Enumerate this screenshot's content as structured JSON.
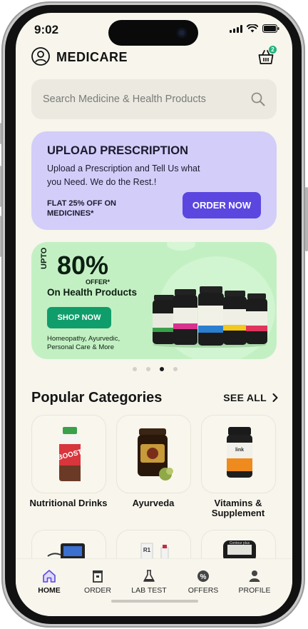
{
  "status": {
    "time": "9:02"
  },
  "header": {
    "app_title": "MEDICARE",
    "cart_count": "2"
  },
  "search": {
    "placeholder": "Search Medicine & Health Products"
  },
  "upload_card": {
    "title": "UPLOAD PRESCRIPTION",
    "description": "Upload a Prescription and Tell Us what you Need. We do the Rest.!",
    "offer": "FLAT 25% OFF ON MEDICINES*",
    "button": "ORDER NOW",
    "bg_color": "#d3cdf9",
    "button_color": "#5b47e0"
  },
  "promo_card": {
    "upto": "UPTO",
    "percent": "80%",
    "offer": "OFFER*",
    "headline": "On Health Products",
    "button": "SHOP NOW",
    "subtitle": "Homeopathy, Ayurvedic, Personal Care & More",
    "bg_color": "#c3f0c3",
    "button_color": "#0f9d6b"
  },
  "carousel": {
    "count": 4,
    "active_index": 2
  },
  "categories": {
    "title": "Popular Categories",
    "see_all": "SEE ALL",
    "items": [
      {
        "name": "Nutritional Drinks"
      },
      {
        "name": "Ayurveda"
      },
      {
        "name": "Vitamins & Supplement"
      }
    ]
  },
  "tabbar": {
    "items": [
      {
        "label": "HOME",
        "icon": "home-icon",
        "active": true
      },
      {
        "label": "ORDER",
        "icon": "order-icon",
        "active": false
      },
      {
        "label": "LAB TEST",
        "icon": "flask-icon",
        "active": false
      },
      {
        "label": "OFFERS",
        "icon": "offer-badge-icon",
        "active": false
      },
      {
        "label": "PROFILE",
        "icon": "person-icon",
        "active": false
      }
    ]
  }
}
